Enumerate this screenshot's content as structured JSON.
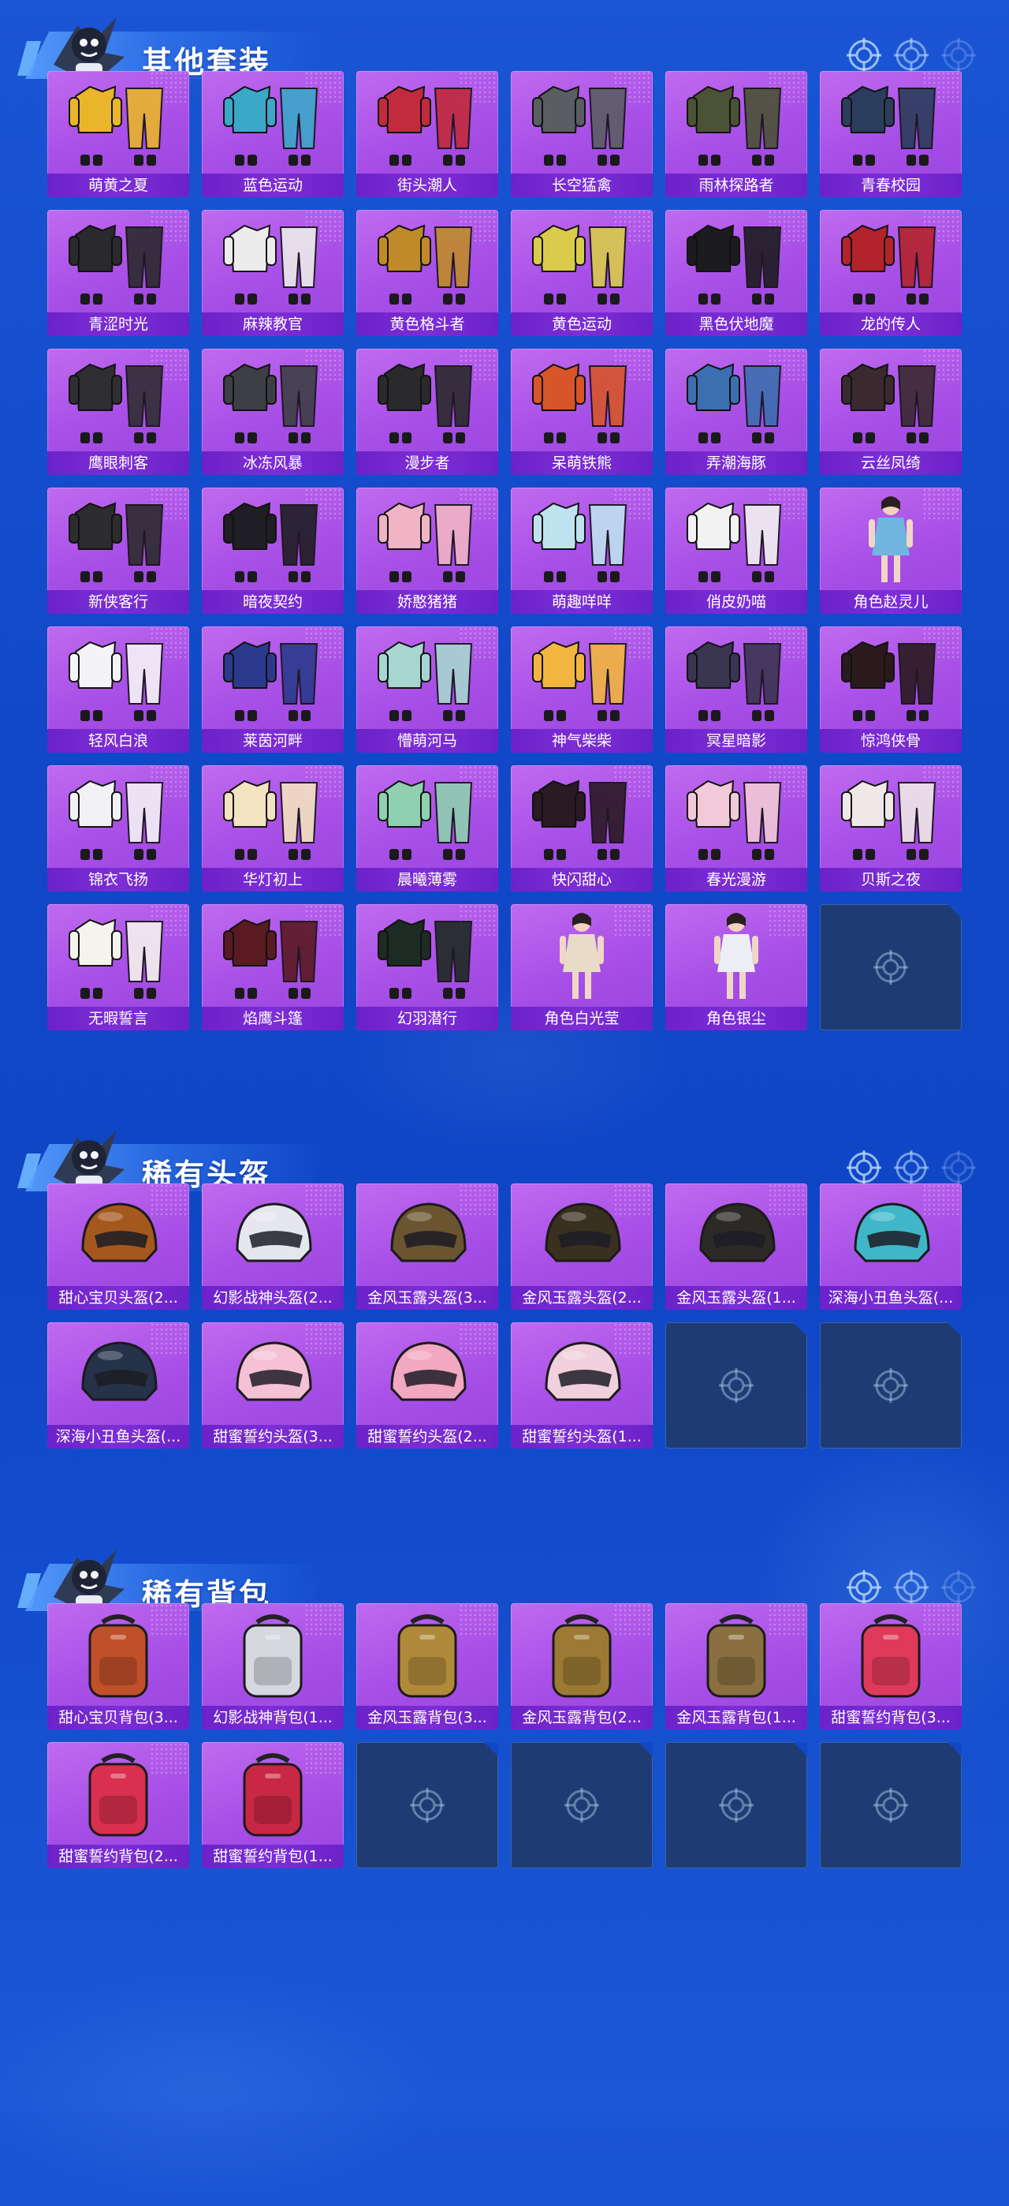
{
  "sections": [
    {
      "title": "其他套装",
      "items": [
        {
          "label": "萌黄之夏",
          "icon": "outfit-icon",
          "color": "#e9b52a"
        },
        {
          "label": "蓝色运动",
          "icon": "outfit-icon",
          "color": "#3ba7c9"
        },
        {
          "label": "街头潮人",
          "icon": "outfit-icon",
          "color": "#c22a3d"
        },
        {
          "label": "长空猛禽",
          "icon": "outfit-icon",
          "color": "#5a5e63"
        },
        {
          "label": "雨林探路者",
          "icon": "outfit-icon",
          "color": "#4b5236"
        },
        {
          "label": "青春校园",
          "icon": "outfit-icon",
          "color": "#2b3d5c"
        },
        {
          "label": "青涩时光",
          "icon": "outfit-icon",
          "color": "#2a2a2e"
        },
        {
          "label": "麻辣教官",
          "icon": "outfit-icon",
          "color": "#ececec"
        },
        {
          "label": "黄色格斗者",
          "icon": "outfit-icon",
          "color": "#c08a2a"
        },
        {
          "label": "黄色运动",
          "icon": "outfit-icon",
          "color": "#d9cc4a"
        },
        {
          "label": "黑色伏地魔",
          "icon": "outfit-icon",
          "color": "#1c1c20"
        },
        {
          "label": "龙的传人",
          "icon": "outfit-icon",
          "color": "#b3232b"
        },
        {
          "label": "鹰眼刺客",
          "icon": "outfit-icon",
          "color": "#2f2f33"
        },
        {
          "label": "冰冻风暴",
          "icon": "outfit-icon",
          "color": "#3d3f45"
        },
        {
          "label": "漫步者",
          "icon": "outfit-icon",
          "color": "#2a2a2c"
        },
        {
          "label": "呆萌铁熊",
          "icon": "outfit-icon",
          "color": "#d8552a"
        },
        {
          "label": "弄潮海豚",
          "icon": "outfit-icon",
          "color": "#3c6fb0"
        },
        {
          "label": "云丝凤绮",
          "icon": "outfit-icon",
          "color": "#3a2a30"
        },
        {
          "label": "新侠客行",
          "icon": "outfit-icon",
          "color": "#2c2c2e"
        },
        {
          "label": "暗夜契约",
          "icon": "outfit-icon",
          "color": "#1e1e24"
        },
        {
          "label": "娇憨猪猪",
          "icon": "outfit-icon",
          "color": "#f1b4c6"
        },
        {
          "label": "萌趣咩咩",
          "icon": "outfit-icon",
          "color": "#bfe2f0"
        },
        {
          "label": "俏皮奶喵",
          "icon": "outfit-icon",
          "color": "#f2f2f2"
        },
        {
          "label": "角色赵灵儿",
          "icon": "character-icon",
          "color": "#6fb6e0"
        },
        {
          "label": "轻风白浪",
          "icon": "outfit-icon",
          "color": "#f4f4f8"
        },
        {
          "label": "莱茵河畔",
          "icon": "outfit-icon",
          "color": "#2b3a8c"
        },
        {
          "label": "懵萌河马",
          "icon": "outfit-icon",
          "color": "#a7d6d0"
        },
        {
          "label": "神气柴柴",
          "icon": "outfit-icon",
          "color": "#f2b640"
        },
        {
          "label": "冥星暗影",
          "icon": "outfit-icon",
          "color": "#3a3550"
        },
        {
          "label": "惊鸿侠骨",
          "icon": "outfit-icon",
          "color": "#2a1a1e"
        },
        {
          "label": "锦衣飞扬",
          "icon": "outfit-icon",
          "color": "#f2f2f6"
        },
        {
          "label": "华灯初上",
          "icon": "outfit-icon",
          "color": "#f4e3c0"
        },
        {
          "label": "晨曦薄雾",
          "icon": "outfit-icon",
          "color": "#8ed0b0"
        },
        {
          "label": "快闪甜心",
          "icon": "outfit-icon",
          "color": "#2a1a24"
        },
        {
          "label": "春光漫游",
          "icon": "outfit-icon",
          "color": "#f2c9d8"
        },
        {
          "label": "贝斯之夜",
          "icon": "outfit-icon",
          "color": "#f0e8e8"
        },
        {
          "label": "无暇誓言",
          "icon": "outfit-icon",
          "color": "#f6f2ee"
        },
        {
          "label": "焰鹰斗篷",
          "icon": "outfit-icon",
          "color": "#5a1a22"
        },
        {
          "label": "幻羽潜行",
          "icon": "outfit-icon",
          "color": "#1e2a24"
        },
        {
          "label": "角色白光莹",
          "icon": "character-icon",
          "color": "#e8dcc8"
        },
        {
          "label": "角色银尘",
          "icon": "character-icon",
          "color": "#eceef4"
        },
        {
          "label": "",
          "empty": true
        }
      ]
    },
    {
      "title": "稀有头盔",
      "items": [
        {
          "label": "甜心宝贝头盔(2...",
          "icon": "helmet-icon",
          "color": "#a5581e"
        },
        {
          "label": "幻影战神头盔(2...",
          "icon": "helmet-icon",
          "color": "#e6e6ee"
        },
        {
          "label": "金风玉露头盔(3...",
          "icon": "helmet-icon",
          "color": "#6a5530"
        },
        {
          "label": "金风玉露头盔(2...",
          "icon": "helmet-icon",
          "color": "#3a3020"
        },
        {
          "label": "金风玉露头盔(1...",
          "icon": "helmet-icon",
          "color": "#2c2a26"
        },
        {
          "label": "深海小丑鱼头盔(...",
          "icon": "helmet-icon",
          "color": "#3fb7c8"
        },
        {
          "label": "深海小丑鱼头盔(...",
          "icon": "helmet-icon",
          "color": "#26324a"
        },
        {
          "label": "甜蜜誓约头盔(3...",
          "icon": "helmet-icon",
          "color": "#f4c2d4"
        },
        {
          "label": "甜蜜誓约头盔(2...",
          "icon": "helmet-icon",
          "color": "#f2a8c0"
        },
        {
          "label": "甜蜜誓约头盔(1...",
          "icon": "helmet-icon",
          "color": "#f0d0dc"
        },
        {
          "label": "",
          "empty": true
        },
        {
          "label": "",
          "empty": true
        }
      ]
    },
    {
      "title": "稀有背包",
      "items": [
        {
          "label": "甜心宝贝背包(3...",
          "icon": "backpack-icon",
          "color": "#c0502a"
        },
        {
          "label": "幻影战神背包(1...",
          "icon": "backpack-icon",
          "color": "#d6d8e0"
        },
        {
          "label": "金风玉露背包(3...",
          "icon": "backpack-icon",
          "color": "#b08a3a"
        },
        {
          "label": "金风玉露背包(2...",
          "icon": "backpack-icon",
          "color": "#9c7a34"
        },
        {
          "label": "金风玉露背包(1...",
          "icon": "backpack-icon",
          "color": "#8a7040"
        },
        {
          "label": "甜蜜誓约背包(3...",
          "icon": "backpack-icon",
          "color": "#e03a5a"
        },
        {
          "label": "甜蜜誓约背包(2...",
          "icon": "backpack-icon",
          "color": "#d8304e"
        },
        {
          "label": "甜蜜誓约背包(1...",
          "icon": "backpack-icon",
          "color": "#c82844"
        },
        {
          "label": "",
          "empty": true
        },
        {
          "label": "",
          "empty": true
        },
        {
          "label": "",
          "empty": true
        },
        {
          "label": "",
          "empty": true
        }
      ]
    }
  ]
}
